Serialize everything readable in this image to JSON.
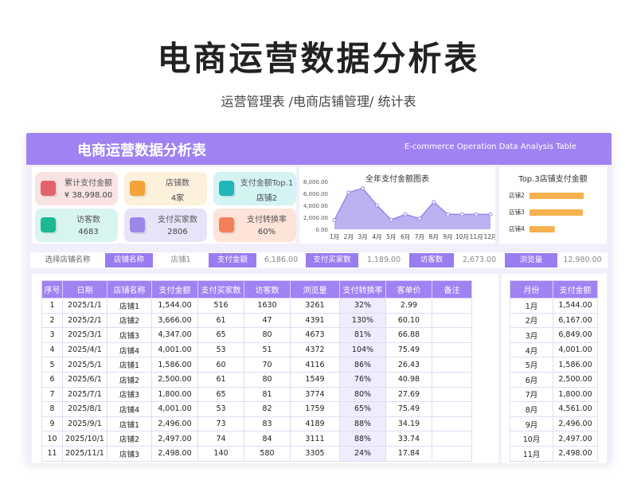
{
  "page": {
    "title": "电商运营数据分析表",
    "subtitle": "运营管理表 /电商店铺管理/ 统计表"
  },
  "banner": {
    "title": "电商运营数据分析表",
    "en_title": "E-commerce Operation Data Analysis Table"
  },
  "kpis": [
    {
      "label": "累计支付金额",
      "value": "¥ 38,998.00",
      "bg": "#f9e3e3",
      "icon": "#e2646a",
      "icon_name": "payment-icon"
    },
    {
      "label": "店铺数",
      "value": "4家",
      "bg": "#fdf1dc",
      "icon": "#f4a23a",
      "icon_name": "store-icon"
    },
    {
      "label": "支付金额Top.1",
      "value": "店铺2",
      "bg": "#d4f3f3",
      "icon": "#21b6b8",
      "icon_name": "trophy-icon"
    },
    {
      "label": "访客数",
      "value": "4683",
      "bg": "#d8f4ee",
      "icon": "#1bb892",
      "icon_name": "visitor-icon"
    },
    {
      "label": "支付买家数",
      "value": "2806",
      "bg": "#e7e3f9",
      "icon": "#9b86ea",
      "icon_name": "buyer-icon"
    },
    {
      "label": "支付转换率",
      "value": "60%",
      "bg": "#fde3d8",
      "icon": "#f2805b",
      "icon_name": "conversion-icon"
    }
  ],
  "line_chart": {
    "title": "全年支付金额图表",
    "type": "area",
    "y_ticks": [
      "8,000.00",
      "6,000.00",
      "4,000.00",
      "2,000.00",
      "0.00"
    ],
    "categories": [
      "1月",
      "2月",
      "3月",
      "4月",
      "5月",
      "6月",
      "7月",
      "8月",
      "9月",
      "10月",
      "11月",
      "12月"
    ]
  },
  "bar_chart": {
    "title": "Top.3店铺支付金额",
    "type": "bar",
    "color": "#f6b14f"
  },
  "filter": {
    "select_label": "选择店铺名称",
    "store_key": "店铺名称",
    "store_value": "店铺1",
    "pay_key": "支付金额",
    "pay_value": "6,186.00",
    "buyer_key": "支付买家数",
    "buyer_value": "1,189.00",
    "visitor_key": "访客数",
    "visitor_value": "2,673.00",
    "view_key": "浏览量",
    "view_value": "12,980.00"
  },
  "main_table": {
    "headers": [
      "序号",
      "日期",
      "店铺名称",
      "支付金额",
      "支付买家数",
      "访客数",
      "浏览量",
      "支付转换率",
      "客单价",
      "备注"
    ],
    "rows": [
      [
        "1",
        "2025/1/1",
        "店铺1",
        "1,544.00",
        "516",
        "1630",
        "3261",
        "32%",
        "2.99",
        ""
      ],
      [
        "2",
        "2025/2/1",
        "店铺2",
        "3,666.00",
        "61",
        "47",
        "4391",
        "130%",
        "60.10",
        ""
      ],
      [
        "3",
        "2025/3/1",
        "店铺3",
        "4,347.00",
        "65",
        "80",
        "4673",
        "81%",
        "66.88",
        ""
      ],
      [
        "4",
        "2025/4/1",
        "店铺4",
        "4,001.00",
        "53",
        "51",
        "4372",
        "104%",
        "75.49",
        ""
      ],
      [
        "5",
        "2025/5/1",
        "店铺1",
        "1,586.00",
        "60",
        "70",
        "4116",
        "86%",
        "26.43",
        ""
      ],
      [
        "6",
        "2025/6/1",
        "店铺2",
        "2,500.00",
        "61",
        "80",
        "1549",
        "76%",
        "40.98",
        ""
      ],
      [
        "7",
        "2025/7/1",
        "店铺3",
        "1,800.00",
        "65",
        "81",
        "3774",
        "80%",
        "27.69",
        ""
      ],
      [
        "8",
        "2025/8/1",
        "店铺4",
        "4,001.00",
        "53",
        "82",
        "1759",
        "65%",
        "75.49",
        ""
      ],
      [
        "9",
        "2025/9/1",
        "店铺1",
        "2,496.00",
        "73",
        "83",
        "4189",
        "88%",
        "34.19",
        ""
      ],
      [
        "10",
        "2025/10/1",
        "店铺2",
        "2,497.00",
        "74",
        "84",
        "3111",
        "88%",
        "33.74",
        ""
      ],
      [
        "11",
        "2025/11/1",
        "店铺3",
        "2,498.00",
        "140",
        "580",
        "3305",
        "24%",
        "17.84",
        ""
      ]
    ]
  },
  "month_table": {
    "headers": [
      "月份",
      "支付金额"
    ],
    "rows": [
      [
        "1月",
        "1,544.00"
      ],
      [
        "2月",
        "6,167.00"
      ],
      [
        "3月",
        "6,849.00"
      ],
      [
        "4月",
        "4,001.00"
      ],
      [
        "5月",
        "1,586.00"
      ],
      [
        "6月",
        "2,500.00"
      ],
      [
        "7月",
        "1,800.00"
      ],
      [
        "8月",
        "4,561.00"
      ],
      [
        "9月",
        "2,496.00"
      ],
      [
        "10月",
        "2,497.00"
      ],
      [
        "11月",
        "2,498.00"
      ]
    ]
  },
  "chart_data": [
    {
      "type": "area",
      "title": "全年支付金额图表",
      "categories": [
        "1月",
        "2月",
        "3月",
        "4月",
        "5月",
        "6月",
        "7月",
        "8月",
        "9月",
        "10月",
        "11月",
        "12月"
      ],
      "values": [
        1544,
        6167,
        6849,
        4001,
        1586,
        2500,
        1800,
        4561,
        2496,
        2497,
        2498,
        2498
      ],
      "ylim": [
        0,
        8000
      ],
      "y_ticks": [
        0,
        2000,
        4000,
        6000,
        8000
      ],
      "grid": false,
      "color": "#a898ec"
    },
    {
      "type": "bar",
      "orientation": "horizontal",
      "title": "Top.3店铺支付金额",
      "categories": [
        "店铺2",
        "店铺3",
        "店铺4"
      ],
      "values": [
        12000,
        11800,
        5600
      ],
      "color": "#f6b14f"
    }
  ]
}
